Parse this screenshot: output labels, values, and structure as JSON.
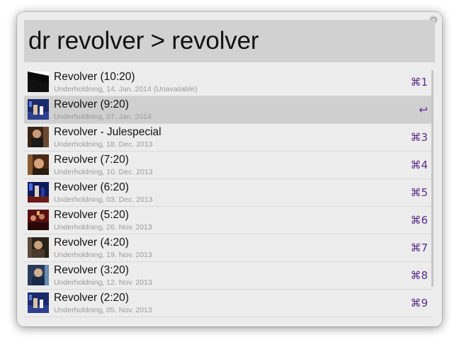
{
  "search": {
    "query": "dr revolver > revolver"
  },
  "results": [
    {
      "title": "Revolver (10:20)",
      "subtitle": "Underholdning, 14. Jan. 2014 (Unavailable)",
      "shortcut": "⌘1",
      "selected": false,
      "thumb": "black-diagonal"
    },
    {
      "title": "Revolver (9:20)",
      "subtitle": "Underholdning, 07. Jan. 2014",
      "shortcut": "↩",
      "selected": true,
      "thumb": "stage-blue"
    },
    {
      "title": "Revolver - Julespecial",
      "subtitle": "Underholdning, 18. Dec. 2013",
      "shortcut": "⌘3",
      "selected": false,
      "thumb": "person-dark"
    },
    {
      "title": "Revolver (7:20)",
      "subtitle": "Underholdning, 10. Dec. 2013",
      "shortcut": "⌘4",
      "selected": false,
      "thumb": "face-warm"
    },
    {
      "title": "Revolver (6:20)",
      "subtitle": "Underholdning, 03. Dec. 2013",
      "shortcut": "⌘5",
      "selected": false,
      "thumb": "stage-blue-red"
    },
    {
      "title": "Revolver (5:20)",
      "subtitle": "Underholdning, 26. Nov. 2013",
      "shortcut": "⌘6",
      "selected": false,
      "thumb": "crowd-red"
    },
    {
      "title": "Revolver (4:20)",
      "subtitle": "Underholdning, 19. Nov. 2013",
      "shortcut": "⌘7",
      "selected": false,
      "thumb": "person-brown"
    },
    {
      "title": "Revolver (3:20)",
      "subtitle": "Underholdning, 12. Nov. 2013",
      "shortcut": "⌘8",
      "selected": false,
      "thumb": "person-blue"
    },
    {
      "title": "Revolver (2:20)",
      "subtitle": "Underholdning, 05. Nov. 2013",
      "shortcut": "⌘9",
      "selected": false,
      "thumb": "stage-blue"
    }
  ],
  "icons": {
    "settings": "gear-icon"
  },
  "colors": {
    "shortcut": "#5a2a8a",
    "selected_row": "#cfcfcf",
    "search_bg": "#d1d1d1"
  }
}
